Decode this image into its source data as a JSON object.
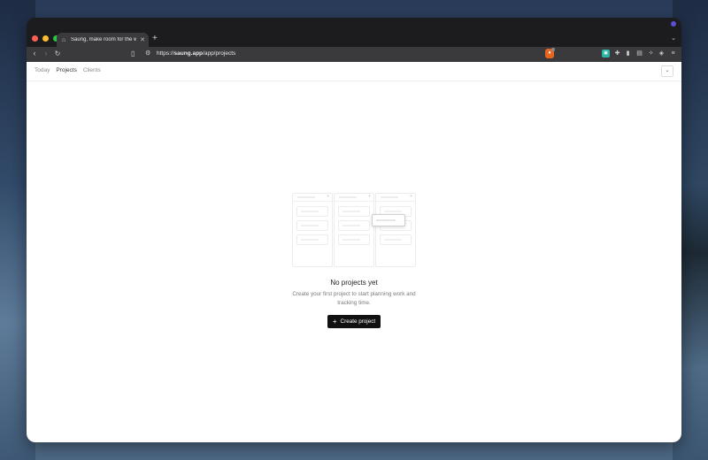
{
  "browser": {
    "tab": {
      "title": "Saung, make room for the wo",
      "icon": "home-icon"
    },
    "new_tab": "+",
    "url": {
      "scheme": "https://",
      "host": "saung.app",
      "path": "/app/projects"
    }
  },
  "app": {
    "nav": {
      "items": [
        {
          "label": "Today",
          "active": false
        },
        {
          "label": "Projects",
          "active": true
        },
        {
          "label": "Clients",
          "active": false
        }
      ]
    },
    "empty_state": {
      "title": "No projects yet",
      "description": "Create your first project to start planning work and tracking time.",
      "cta_label": "Create project"
    }
  },
  "colors": {
    "primary_button": "#111111",
    "active_nav_text": "#3a3a3d",
    "inactive_nav_text": "#8b8b90"
  }
}
